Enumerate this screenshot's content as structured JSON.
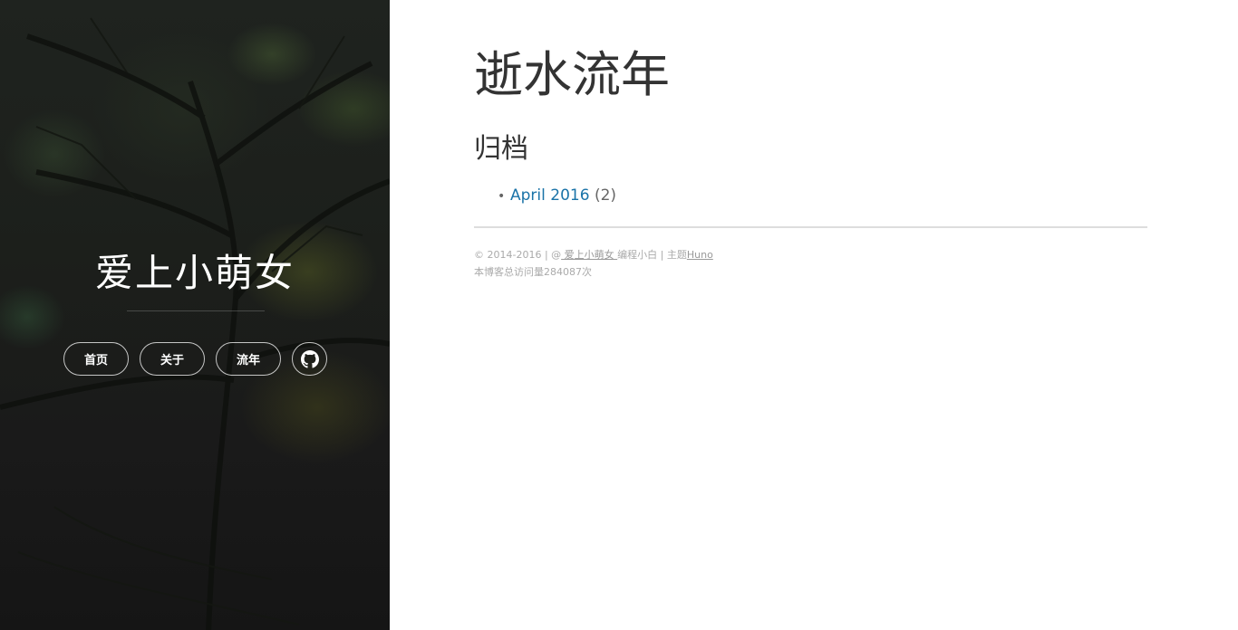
{
  "sidebar": {
    "site_title": "爱上小萌女",
    "nav": [
      {
        "label": "首页"
      },
      {
        "label": "关于"
      },
      {
        "label": "流年"
      }
    ],
    "github_icon": "github-icon"
  },
  "main": {
    "page_title": "逝水流年",
    "section_title": "归档",
    "archives": [
      {
        "month": "April 2016",
        "count": "(2)"
      }
    ]
  },
  "footer": {
    "copyright_prefix": "© 2014-2016 | @",
    "author_link": " 爱上小萌女 ",
    "author_suffix": "编程小白 | 主题",
    "theme_link": "Huno",
    "visits": "本博客总访问量284087次"
  },
  "colors": {
    "link": "#1a73a8",
    "sidebar_bg": "#1c1f1b"
  }
}
